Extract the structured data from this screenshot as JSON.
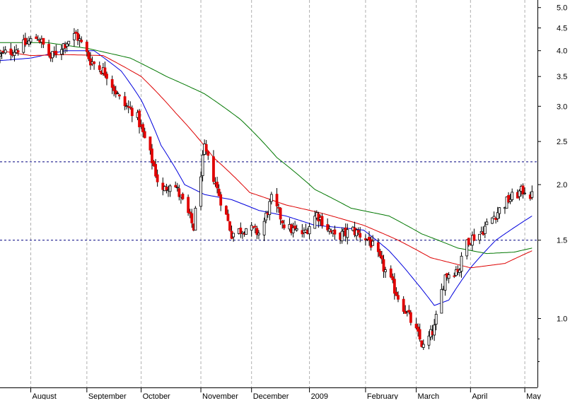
{
  "chart_data": {
    "type": "candlestick",
    "title": "",
    "xlabel": "",
    "ylabel": "",
    "y_scale": "log",
    "ylim": [
      0.7,
      5.2
    ],
    "y_ticks": [
      {
        "value": 5.0,
        "label": "5.0"
      },
      {
        "value": 4.5,
        "label": "4.5"
      },
      {
        "value": 4.0,
        "label": "4.0"
      },
      {
        "value": 3.5,
        "label": "3.5"
      },
      {
        "value": 3.0,
        "label": "3.0"
      },
      {
        "value": 2.5,
        "label": "2.5"
      },
      {
        "value": 2.0,
        "label": "2.0"
      },
      {
        "value": 1.5,
        "label": "1.5"
      },
      {
        "value": 1.0,
        "label": "1.0"
      }
    ],
    "x_range": [
      "2008-07-15",
      "2009-05-08"
    ],
    "x_ticks": [
      {
        "date": "2008-08-01",
        "label": "August"
      },
      {
        "date": "2008-09-01",
        "label": "September"
      },
      {
        "date": "2008-10-01",
        "label": "October"
      },
      {
        "date": "2008-11-03",
        "label": "November"
      },
      {
        "date": "2008-12-01",
        "label": "December"
      },
      {
        "date": "2009-01-02",
        "label": "2009"
      },
      {
        "date": "2009-02-02",
        "label": "February"
      },
      {
        "date": "2009-03-02",
        "label": "March"
      },
      {
        "date": "2009-04-01",
        "label": "April"
      },
      {
        "date": "2009-05-01",
        "label": "May"
      }
    ],
    "reference_lines": [
      2.25,
      1.5
    ],
    "grid": "vertical-dashed",
    "colors": {
      "up_candle": "#ffffff",
      "down_candle": "#e00000",
      "wick": "#000000",
      "ma_short": "#0000dd",
      "ma_medium": "#dd0000",
      "ma_long": "#007700",
      "reference": "#000080",
      "grid": "#b0b0b0"
    },
    "price_path": [
      [
        "2008-07-15",
        3.9
      ],
      [
        "2008-07-25",
        4.05
      ],
      [
        "2008-08-05",
        4.3
      ],
      [
        "2008-08-12",
        3.85
      ],
      [
        "2008-08-18",
        4.1
      ],
      [
        "2008-08-26",
        4.35
      ],
      [
        "2008-09-03",
        3.8
      ],
      [
        "2008-09-12",
        3.55
      ],
      [
        "2008-09-20",
        3.05
      ],
      [
        "2008-09-28",
        2.9
      ],
      [
        "2008-10-02",
        2.6
      ],
      [
        "2008-10-08",
        2.2
      ],
      [
        "2008-10-12",
        1.9
      ],
      [
        "2008-10-18",
        2.05
      ],
      [
        "2008-10-26",
        1.75
      ],
      [
        "2008-10-30",
        1.6
      ],
      [
        "2008-11-05",
        2.4
      ],
      [
        "2008-11-12",
        1.95
      ],
      [
        "2008-11-20",
        1.55
      ],
      [
        "2008-11-28",
        1.6
      ],
      [
        "2008-12-06",
        1.55
      ],
      [
        "2008-12-12",
        1.85
      ],
      [
        "2008-12-20",
        1.6
      ],
      [
        "2008-12-30",
        1.55
      ],
      [
        "2009-01-06",
        1.72
      ],
      [
        "2009-01-16",
        1.52
      ],
      [
        "2009-01-26",
        1.58
      ],
      [
        "2009-02-04",
        1.5
      ],
      [
        "2009-02-12",
        1.3
      ],
      [
        "2009-02-20",
        1.12
      ],
      [
        "2009-02-28",
        0.97
      ],
      [
        "2009-03-06",
        0.86
      ],
      [
        "2009-03-12",
        0.95
      ],
      [
        "2009-03-18",
        1.25
      ],
      [
        "2009-03-26",
        1.3
      ],
      [
        "2009-03-30",
        1.5
      ],
      [
        "2009-04-06",
        1.55
      ],
      [
        "2009-04-14",
        1.7
      ],
      [
        "2009-04-22",
        1.85
      ],
      [
        "2009-05-01",
        1.95
      ],
      [
        "2009-05-05",
        1.88
      ]
    ],
    "moving_averages": [
      {
        "key": "ma_short",
        "points": [
          [
            "2008-07-15",
            3.8
          ],
          [
            "2008-08-01",
            3.85
          ],
          [
            "2008-08-20",
            4.0
          ],
          [
            "2008-09-05",
            4.0
          ],
          [
            "2008-09-20",
            3.6
          ],
          [
            "2008-10-01",
            3.1
          ],
          [
            "2008-10-12",
            2.45
          ],
          [
            "2008-10-25",
            2.0
          ],
          [
            "2008-11-05",
            1.9
          ],
          [
            "2008-11-20",
            1.85
          ],
          [
            "2008-12-05",
            1.75
          ],
          [
            "2008-12-20",
            1.7
          ],
          [
            "2009-01-05",
            1.62
          ],
          [
            "2009-01-20",
            1.6
          ],
          [
            "2009-02-01",
            1.58
          ],
          [
            "2009-02-15",
            1.42
          ],
          [
            "2009-03-01",
            1.22
          ],
          [
            "2009-03-12",
            1.07
          ],
          [
            "2009-03-20",
            1.1
          ],
          [
            "2009-04-01",
            1.3
          ],
          [
            "2009-04-15",
            1.5
          ],
          [
            "2009-05-05",
            1.7
          ]
        ]
      },
      {
        "key": "ma_medium",
        "points": [
          [
            "2008-07-15",
            4.0
          ],
          [
            "2008-08-01",
            3.9
          ],
          [
            "2008-08-20",
            3.92
          ],
          [
            "2008-09-10",
            3.9
          ],
          [
            "2008-10-01",
            3.5
          ],
          [
            "2008-10-20",
            2.9
          ],
          [
            "2008-11-10",
            2.3
          ],
          [
            "2008-11-30",
            1.92
          ],
          [
            "2008-12-20",
            1.8
          ],
          [
            "2009-01-10",
            1.72
          ],
          [
            "2009-02-01",
            1.62
          ],
          [
            "2009-02-20",
            1.5
          ],
          [
            "2009-03-10",
            1.37
          ],
          [
            "2009-04-01",
            1.3
          ],
          [
            "2009-04-20",
            1.33
          ],
          [
            "2009-05-05",
            1.42
          ]
        ]
      },
      {
        "key": "ma_long",
        "points": [
          [
            "2008-07-15",
            4.17
          ],
          [
            "2008-08-10",
            4.17
          ],
          [
            "2008-09-01",
            4.05
          ],
          [
            "2008-09-25",
            3.85
          ],
          [
            "2008-10-15",
            3.5
          ],
          [
            "2008-11-05",
            3.2
          ],
          [
            "2008-11-25",
            2.8
          ],
          [
            "2008-12-15",
            2.3
          ],
          [
            "2009-01-05",
            1.95
          ],
          [
            "2009-01-25",
            1.77
          ],
          [
            "2009-02-15",
            1.7
          ],
          [
            "2009-03-05",
            1.55
          ],
          [
            "2009-03-25",
            1.44
          ],
          [
            "2009-04-10",
            1.4
          ],
          [
            "2009-04-25",
            1.41
          ],
          [
            "2009-05-05",
            1.44
          ]
        ]
      }
    ]
  }
}
